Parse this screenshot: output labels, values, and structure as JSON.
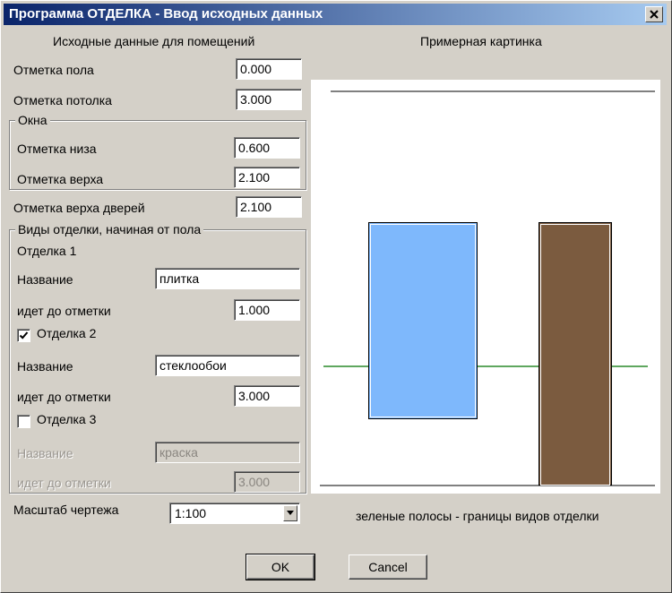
{
  "window": {
    "title": "Программа ОТДЕЛКА - Ввод исходных данных"
  },
  "left": {
    "section_title": "Исходные данные для помещений",
    "floor_label": "Отметка пола",
    "floor_value": "0.000",
    "ceiling_label": "Отметка потолка",
    "ceiling_value": "3.000",
    "windows": {
      "legend": "Окна",
      "bottom_label": "Отметка низа",
      "bottom_value": "0.600",
      "top_label": "Отметка верха",
      "top_value": "2.100"
    },
    "door_top_label": "Отметка верха дверей",
    "door_top_value": "2.100",
    "finishes": {
      "legend": "Виды отделки, начиная от пола",
      "finish1": {
        "header": "Отделка 1",
        "name_label": "Название",
        "name_value": "плитка",
        "upto_label": "идет до отметки",
        "upto_value": "1.000"
      },
      "finish2": {
        "checkbox_label": "Отделка 2",
        "checked": true,
        "name_label": "Название",
        "name_value": "стеклообои",
        "upto_label": "идет до отметки",
        "upto_value": "3.000"
      },
      "finish3": {
        "checkbox_label": "Отделка 3",
        "checked": false,
        "name_label": "Название",
        "name_value": "краска",
        "upto_label": "идет до отметки",
        "upto_value": "3.000"
      }
    },
    "scale_label": "Масштаб чертежа",
    "scale_value": "1:100"
  },
  "preview": {
    "title": "Примерная картинка",
    "caption": "зеленые полосы - границы видов отделки",
    "colors": {
      "window": "#7eb8fc",
      "door": "#7b5b3f",
      "boundary": "#2a8a2a",
      "line": "#000000"
    }
  },
  "buttons": {
    "ok": "OK",
    "cancel": "Cancel"
  }
}
